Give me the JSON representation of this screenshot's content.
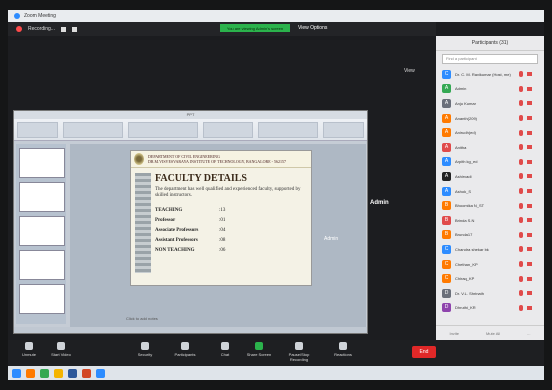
{
  "window": {
    "title": "Zoom Meeting"
  },
  "topbar": {
    "recording_label": "Recording...",
    "talking_label": "You are viewing Admin's screen",
    "view_options_label": "View Options"
  },
  "view_button": "View",
  "shared_window": {
    "title": "PPT",
    "slide": {
      "department": "DEPARTMENT OF CIVIL ENGINEERING",
      "institute": "DR.M.VISVESVARAYA INSTITUTE OF TECHNOLOGY, BANGALORE - 562157",
      "heading": "FACULTY DETAILS",
      "subtitle": "The department has well qualified and experienced faculty, supported by skilled instructors.",
      "rows": [
        {
          "label": "TEACHING",
          "value": ":13"
        },
        {
          "label": "Professor",
          "value": ":01"
        },
        {
          "label": "Associate Professors",
          "value": ":04"
        },
        {
          "label": "Assistant Professors",
          "value": ":08"
        },
        {
          "label": "NON TEACHING",
          "value": ":06"
        }
      ]
    },
    "notes_placeholder": "Click to add notes"
  },
  "video_tile": {
    "name_large": "Admin",
    "name_small": "Admin"
  },
  "participants": {
    "header": "Participants (31)",
    "search_placeholder": "Find a participant",
    "items": [
      {
        "initial": "C",
        "name": "Dr. C. M. Ravikumar (Host, me)",
        "color": "#2d8cff"
      },
      {
        "initial": "A",
        "name": "Admin",
        "color": "#34a853"
      },
      {
        "initial": "A",
        "name": "Anju Kumar",
        "color": "#6a6f7a"
      },
      {
        "initial": "A",
        "name": "Ananth(209)",
        "color": "#ff7a00"
      },
      {
        "initial": "A",
        "name": "Anirudh(ed)",
        "color": "#ff7a00"
      },
      {
        "initial": "A",
        "name": "Anitha",
        "color": "#e04a4a"
      },
      {
        "initial": "A",
        "name": "Arpith kg_ed",
        "color": "#2d8cff"
      },
      {
        "initial": "A",
        "name": "Ashirvadi",
        "color": "#222"
      },
      {
        "initial": "A",
        "name": "Ashok_S",
        "color": "#2d8cff"
      },
      {
        "initial": "B",
        "name": "Bhoomika N_ST",
        "color": "#ff7a00"
      },
      {
        "initial": "B",
        "name": "Brinda S.N",
        "color": "#e04a4a"
      },
      {
        "initial": "B",
        "name": "Brunda17",
        "color": "#ff7a00"
      },
      {
        "initial": "C",
        "name": "Chandra shekar bk",
        "color": "#2d8cff"
      },
      {
        "initial": "C",
        "name": "Chethan_KP",
        "color": "#ff7a00"
      },
      {
        "initial": "C",
        "name": "Chiraq_KP",
        "color": "#ff7a00"
      },
      {
        "initial": "D",
        "name": "Dr. V.L. Shrinath",
        "color": "#6a6f7a"
      },
      {
        "initial": "D",
        "name": "Dhruthi_KR",
        "color": "#8e44ad"
      }
    ],
    "footer": [
      "Invite",
      "Mute All",
      "..."
    ]
  },
  "toolbar": {
    "unmute": "Unmute",
    "start_video": "Start Video",
    "security": "Security",
    "participants": "Participants",
    "participants_count": "31",
    "chat": "Chat",
    "share_screen": "Share Screen",
    "pause_recording": "Pause/Stop Recording",
    "reactions": "Reactions",
    "end": "End"
  },
  "colors": {
    "accent": "#2d8cff",
    "danger": "#e02828",
    "talking": "#2bb24c"
  }
}
